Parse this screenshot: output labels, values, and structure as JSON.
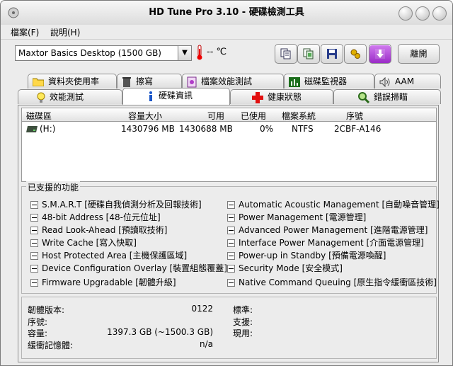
{
  "window": {
    "title": "HD Tune Pro 3.10 - 硬碟檢測工具"
  },
  "menu": {
    "items": [
      {
        "label": "檔案(F)"
      },
      {
        "label": "說明(H)"
      }
    ]
  },
  "toolbar": {
    "drive_selected": "Maxtor  Basics Desktop (1500 GB)",
    "temperature": "-- ℃",
    "icons": [
      "copy-text-icon",
      "copy-screen-icon",
      "save-icon",
      "options-icon",
      "down-arrow-icon"
    ],
    "exit_label": "離開"
  },
  "tabs": {
    "row1": [
      {
        "label": "資料夾使用率",
        "icon": "folder-icon"
      },
      {
        "label": "擦寫",
        "icon": "trash-icon"
      },
      {
        "label": "檔案效能測試",
        "icon": "file-benchmark-icon"
      },
      {
        "label": "磁碟監視器",
        "icon": "chart-icon"
      },
      {
        "label": "AAM",
        "icon": "speaker-icon"
      }
    ],
    "row2": [
      {
        "label": "效能測試",
        "icon": "bulb-icon"
      },
      {
        "label": "硬碟資訊",
        "icon": "info-icon",
        "active": true
      },
      {
        "label": "健康狀態",
        "icon": "health-cross-icon"
      },
      {
        "label": "錯誤掃瞄",
        "icon": "magnifier-icon"
      }
    ]
  },
  "partitions": {
    "headers": [
      "磁碟區",
      "容量大小",
      "可用",
      "已使用",
      "檔案系統",
      "序號"
    ],
    "rows": [
      {
        "volume": "(H:)",
        "capacity": "1430796 MB",
        "free": "1430688 MB",
        "used": "0%",
        "fs": "NTFS",
        "serial": "2CBF-A146"
      }
    ]
  },
  "features": {
    "title": "已支援的功能",
    "left": [
      "S.M.A.R.T [硬碟自我偵測分析及回報技術]",
      "48-bit Address [48-位元位址]",
      "Read Look-Ahead [預讀取技術]",
      "Write Cache [寫入快取]",
      "Host Protected Area [主機保護區域]",
      "Device Configuration Overlay [裝置組態覆蓋]",
      "Firmware Upgradable [韌體升級]"
    ],
    "right": [
      "Automatic Acoustic Management [自動噪音管理]",
      "Power Management [電源管理]",
      "Advanced Power Management [進階電源管理]",
      "Interface Power Management [介面電源管理]",
      "Power-up in Standby [預備電源喚醒]",
      "Security Mode [安全模式]",
      "Native Command Queuing [原生指令緩衝區技術]"
    ]
  },
  "info": {
    "firmware_label": "韌體版本:",
    "firmware_value": "0122",
    "serial_label": "序號:",
    "serial_value": "",
    "capacity_label": "容量:",
    "capacity_value": "1397.3 GB (~1500.3 GB)",
    "buffer_label": "緩衝記憶體:",
    "buffer_value": "n/a",
    "standard_label": "標準:",
    "supported_label": "支援:",
    "active_label": "現用:"
  },
  "colors": {
    "active_tab_bg": "#ffffff",
    "purple_button": "#b04ad8"
  }
}
